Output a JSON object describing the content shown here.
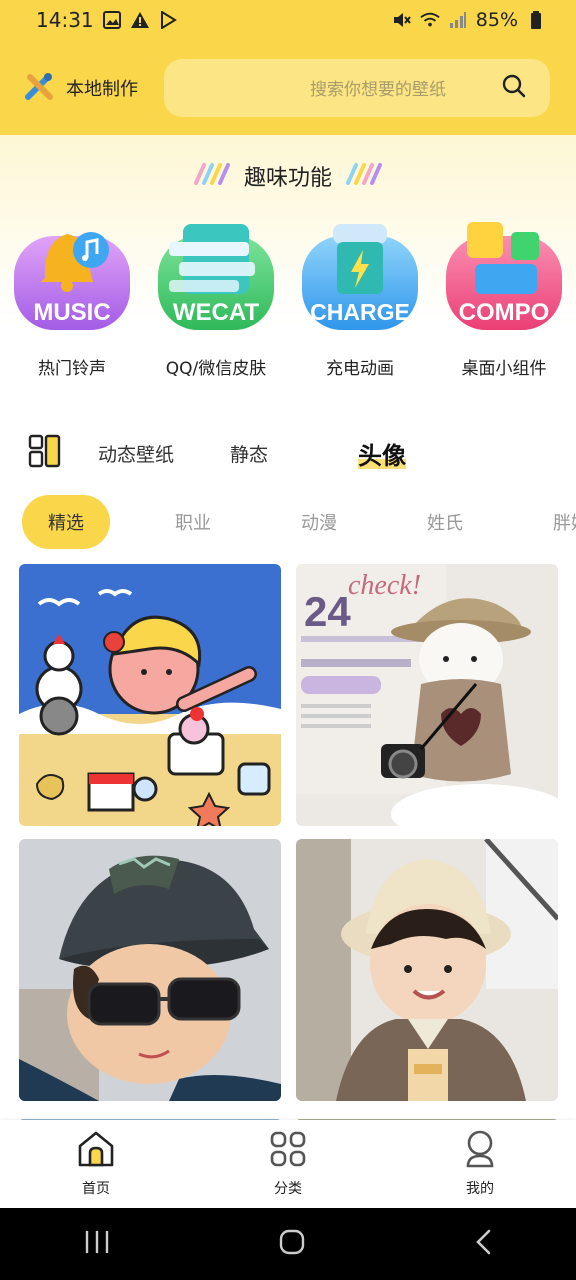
{
  "status_bar": {
    "time": "14:31",
    "battery": "85%"
  },
  "header": {
    "brand_label": "本地制作",
    "search_placeholder": "搜索你想要的壁纸"
  },
  "fun": {
    "title": "趣味功能",
    "features": [
      {
        "label": "热门铃声",
        "badge": "MUSIC",
        "color": "#c77cf0"
      },
      {
        "label": "QQ/微信皮肤",
        "badge": "WECAT",
        "color": "#4fd16e"
      },
      {
        "label": "充电动画",
        "badge": "CHARGE",
        "color": "#4db0f5"
      },
      {
        "label": "桌面小组件",
        "badge": "COMPO",
        "color": "#f25c8c"
      }
    ]
  },
  "tabs": {
    "dynamic": "动态壁纸",
    "static": "静态",
    "avatar": "头像"
  },
  "chips": [
    "精选",
    "职业",
    "动漫",
    "姓氏",
    "胖妞"
  ],
  "bottom_nav": {
    "home": "首页",
    "category": "分类",
    "mine": "我的"
  },
  "colors": {
    "accent": "#f9d64a"
  }
}
